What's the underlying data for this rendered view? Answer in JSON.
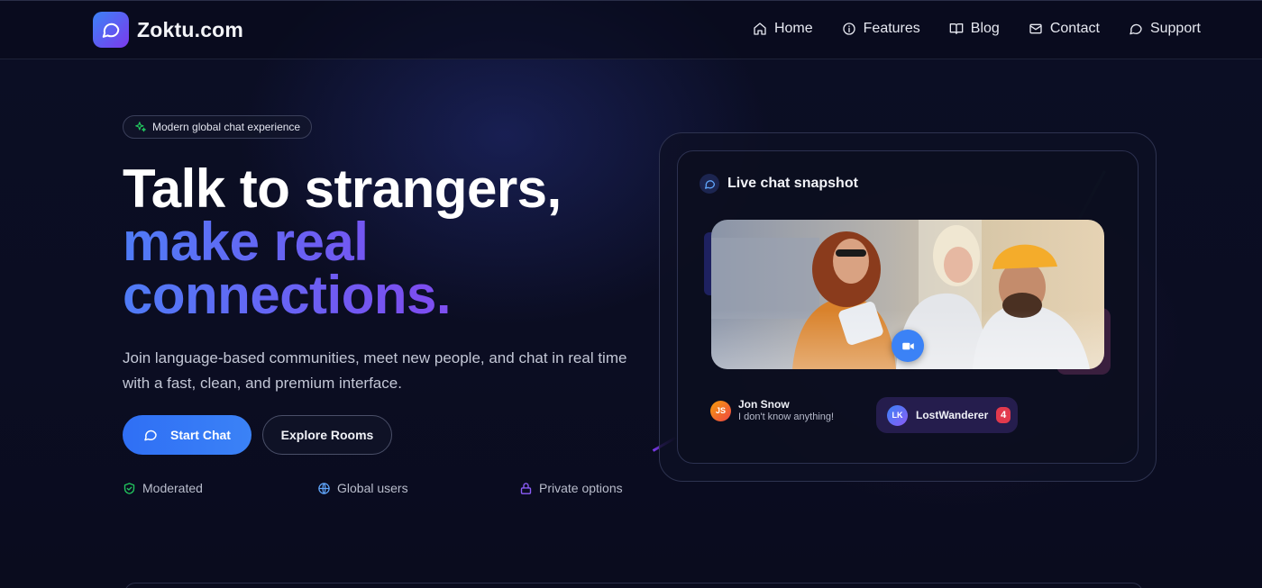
{
  "brand": {
    "name": "Zoktu.com"
  },
  "nav": {
    "items": [
      {
        "label": "Home",
        "icon": "home-icon"
      },
      {
        "label": "Features",
        "icon": "info-icon"
      },
      {
        "label": "Blog",
        "icon": "book-icon"
      },
      {
        "label": "Contact",
        "icon": "mail-icon"
      },
      {
        "label": "Support",
        "icon": "chat-icon"
      }
    ]
  },
  "hero": {
    "badge": "Modern global chat experience",
    "title_line1": "Talk to strangers,",
    "title_line2": "make real",
    "title_line3": "connections.",
    "description": "Join language-based communities, meet new people, and chat in real time with a fast, clean, and premium interface.",
    "primary_button": "Start Chat",
    "secondary_button": "Explore Rooms",
    "features": [
      {
        "label": "Moderated",
        "icon": "shield-check-icon",
        "color": "#22c55e"
      },
      {
        "label": "Global users",
        "icon": "globe-icon",
        "color": "#60a5fa"
      },
      {
        "label": "Private options",
        "icon": "lock-icon",
        "color": "#8b5cf6"
      }
    ]
  },
  "snapshot": {
    "title": "Live chat snapshot",
    "user1": {
      "initials": "JS",
      "name": "Jon Snow",
      "message": "I don't know anything!"
    },
    "user2": {
      "initials": "LK",
      "name": "LostWanderer",
      "count": "4"
    }
  },
  "colors": {
    "background": "#0b0d21",
    "accent_blue": "#3b82f6",
    "accent_purple": "#7c3aed",
    "badge_red": "#e23a4d"
  }
}
